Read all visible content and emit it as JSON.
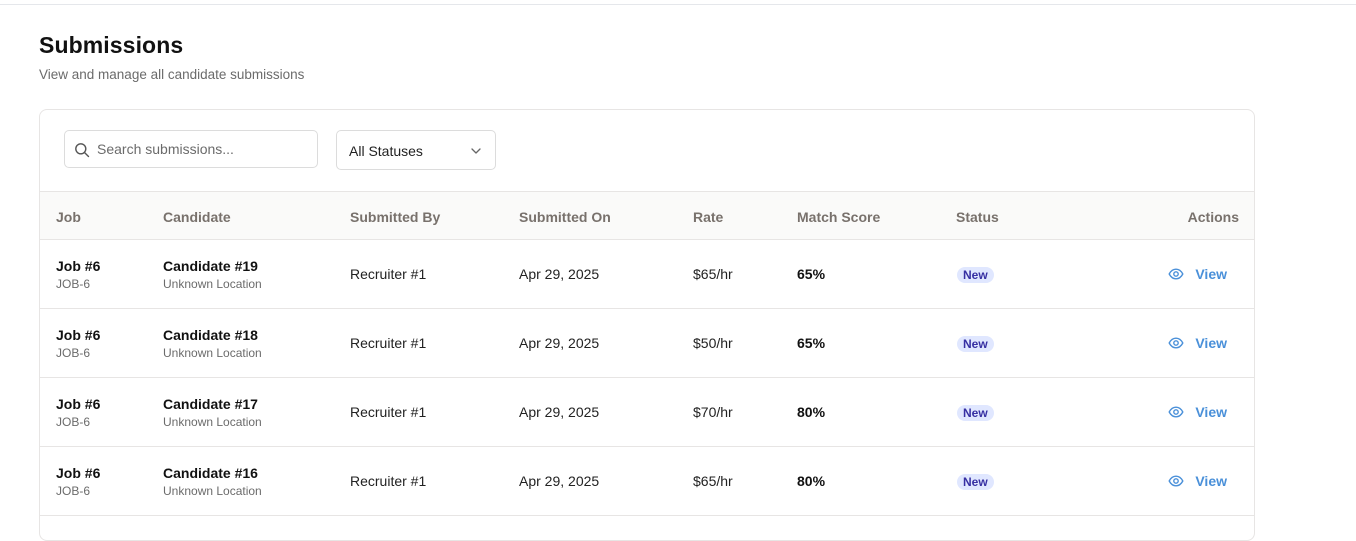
{
  "header": {
    "title": "Submissions",
    "subtitle": "View and manage all candidate submissions"
  },
  "filters": {
    "search_placeholder": "Search submissions...",
    "status_select": "All Statuses"
  },
  "table": {
    "columns": {
      "job": "Job",
      "candidate": "Candidate",
      "submitted_by": "Submitted By",
      "submitted_on": "Submitted On",
      "rate": "Rate",
      "match_score": "Match Score",
      "status": "Status",
      "actions": "Actions"
    },
    "rows": [
      {
        "job": "Job #6",
        "job_code": "JOB-6",
        "candidate": "Candidate #19",
        "location": "Unknown Location",
        "submitted_by": "Recruiter #1",
        "submitted_on": "Apr 29, 2025",
        "rate": "$65/hr",
        "match_score": "65%",
        "status": "New",
        "action": "View"
      },
      {
        "job": "Job #6",
        "job_code": "JOB-6",
        "candidate": "Candidate #18",
        "location": "Unknown Location",
        "submitted_by": "Recruiter #1",
        "submitted_on": "Apr 29, 2025",
        "rate": "$50/hr",
        "match_score": "65%",
        "status": "New",
        "action": "View"
      },
      {
        "job": "Job #6",
        "job_code": "JOB-6",
        "candidate": "Candidate #17",
        "location": "Unknown Location",
        "submitted_by": "Recruiter #1",
        "submitted_on": "Apr 29, 2025",
        "rate": "$70/hr",
        "match_score": "80%",
        "status": "New",
        "action": "View"
      },
      {
        "job": "Job #6",
        "job_code": "JOB-6",
        "candidate": "Candidate #16",
        "location": "Unknown Location",
        "submitted_by": "Recruiter #1",
        "submitted_on": "Apr 29, 2025",
        "rate": "$65/hr",
        "match_score": "80%",
        "status": "New",
        "action": "View"
      }
    ]
  },
  "icons": {
    "search": "search-icon",
    "chevron": "chevron-down-icon",
    "eye": "eye-icon"
  },
  "colors": {
    "badge_bg": "#e0e7ff",
    "badge_text": "#3730a3",
    "link": "#4a90d9"
  }
}
